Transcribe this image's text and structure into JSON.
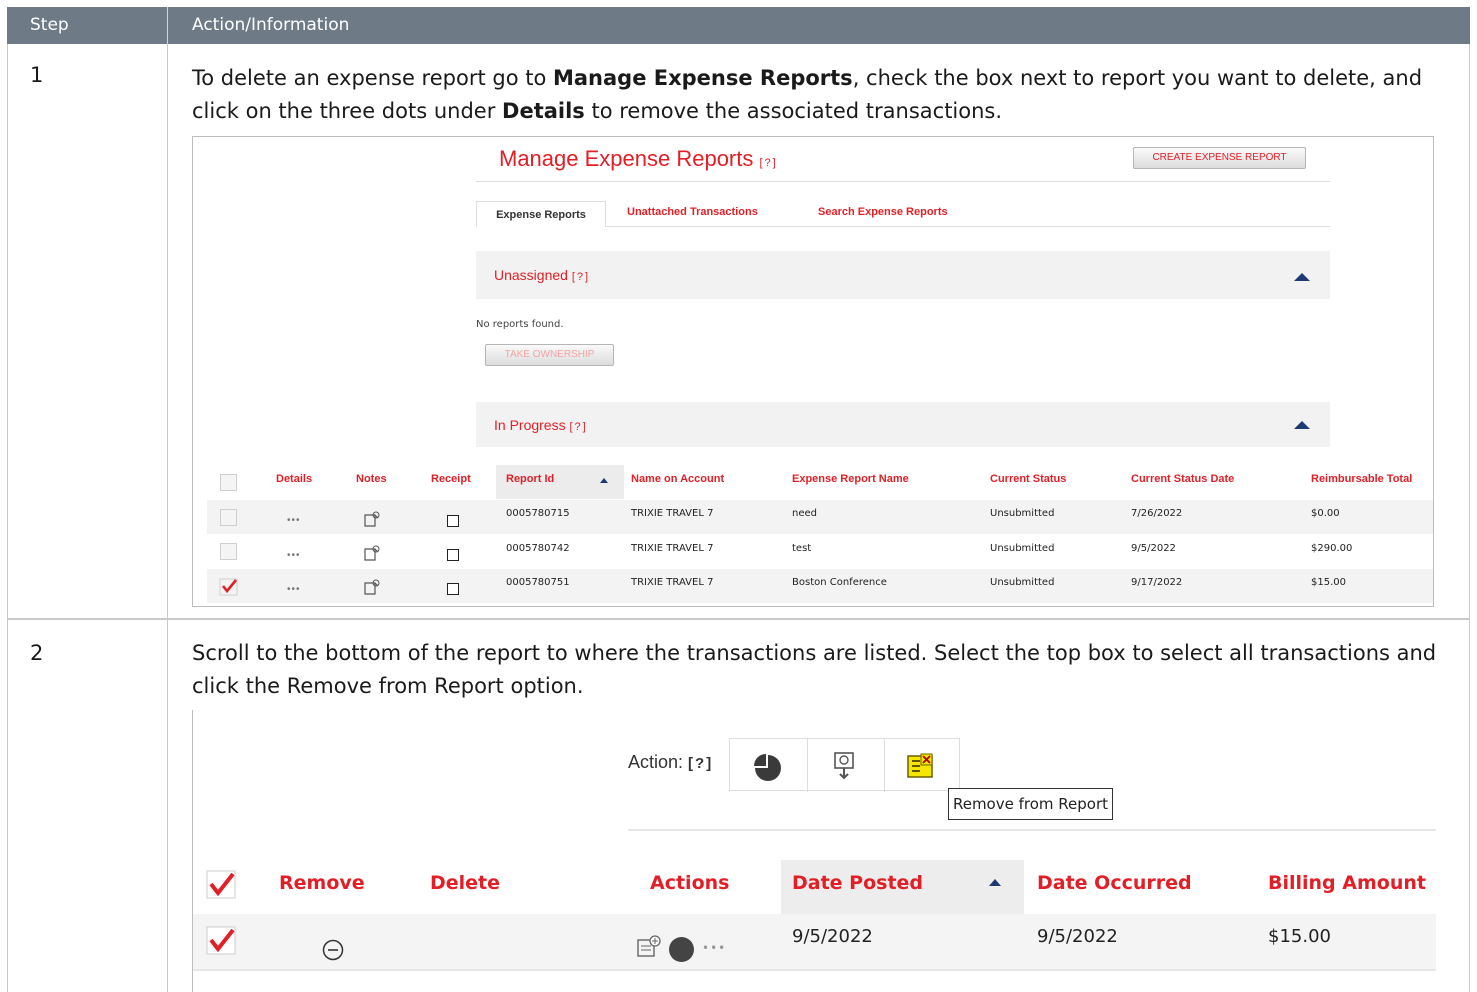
{
  "table_header": {
    "step": "Step",
    "action": "Action/Information"
  },
  "steps": [
    {
      "number": "1",
      "text_parts": [
        "To delete an expense report go to ",
        "Manage Expense Reports",
        ", check the box next to report you want to delete, and click on the three dots under ",
        "Details",
        " to remove the associated transactions."
      ]
    },
    {
      "number": "2",
      "text": "Scroll to the bottom of the report to where the transactions are listed. Select the top box to select all transactions and click the Remove from Report option."
    }
  ],
  "shot1": {
    "title": "Manage Expense Reports",
    "help": "[?]",
    "create_button": "CREATE EXPENSE REPORT",
    "tabs": [
      "Expense Reports",
      "Unattached Transactions",
      "Search Expense Reports"
    ],
    "unassigned": {
      "label": "Unassigned",
      "help": "[?]",
      "empty_text": "No reports found.",
      "button": "TAKE OWNERSHIP"
    },
    "in_progress": {
      "label": "In Progress",
      "help": "[?]"
    },
    "columns": [
      "Details",
      "Notes",
      "Receipt",
      "Report Id",
      "Name on Account",
      "Expense Report Name",
      "Current Status",
      "Current Status Date",
      "Reimbursable Total"
    ],
    "rows": [
      {
        "id": "0005780715",
        "name": "TRIXIE TRAVEL 7",
        "report": "need",
        "status": "Unsubmitted",
        "date": "7/26/2022",
        "total": "$0.00",
        "checked": false
      },
      {
        "id": "0005780742",
        "name": "TRIXIE TRAVEL 7",
        "report": "test",
        "status": "Unsubmitted",
        "date": "9/5/2022",
        "total": "$290.00",
        "checked": false
      },
      {
        "id": "0005780751",
        "name": "TRIXIE TRAVEL 7",
        "report": "Boston Conference",
        "status": "Unsubmitted",
        "date": "9/17/2022",
        "total": "$15.00",
        "checked": true
      }
    ],
    "dots": "•••"
  },
  "shot2": {
    "action_label": "Action:",
    "help": "[?]",
    "tooltip": "Remove from Report",
    "columns": [
      "Remove",
      "Delete",
      "Actions",
      "Date Posted",
      "Date Occurred",
      "Billing Amount"
    ],
    "row": {
      "date_posted": "9/5/2022",
      "date_occurred": "9/5/2022",
      "amount": "$15.00"
    },
    "dots": "•••"
  }
}
